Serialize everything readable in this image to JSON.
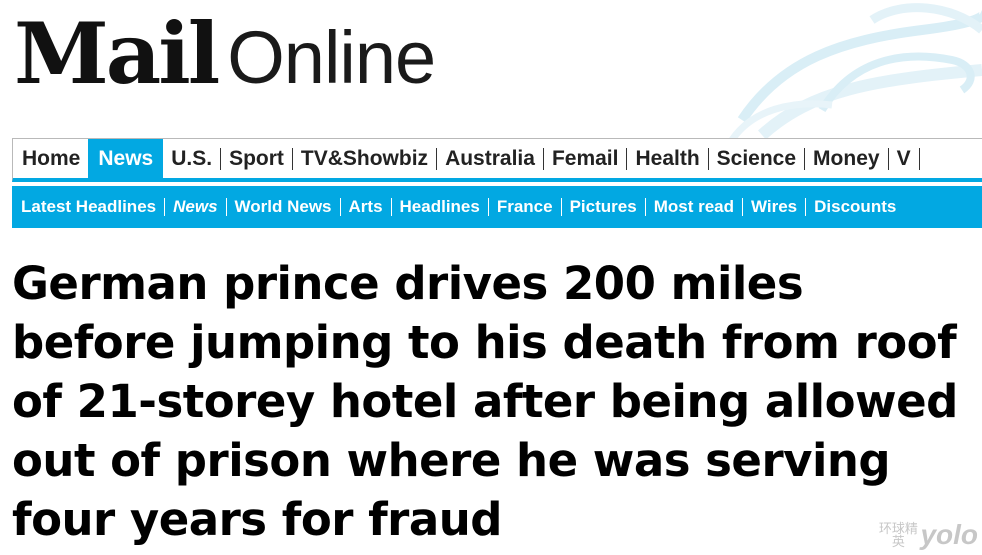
{
  "logo": {
    "mail": "Mail",
    "online": "Online"
  },
  "nav_primary": [
    {
      "label": "Home",
      "active": false
    },
    {
      "label": "News",
      "active": true
    },
    {
      "label": "U.S.",
      "active": false
    },
    {
      "label": "Sport",
      "active": false
    },
    {
      "label": "TV&Showbiz",
      "active": false
    },
    {
      "label": "Australia",
      "active": false
    },
    {
      "label": "Femail",
      "active": false
    },
    {
      "label": "Health",
      "active": false
    },
    {
      "label": "Science",
      "active": false
    },
    {
      "label": "Money",
      "active": false
    },
    {
      "label": "V",
      "active": false
    }
  ],
  "nav_secondary": [
    {
      "label": "Latest Headlines",
      "active": false
    },
    {
      "label": "News",
      "active": true
    },
    {
      "label": "World News",
      "active": false
    },
    {
      "label": "Arts",
      "active": false
    },
    {
      "label": "Headlines",
      "active": false
    },
    {
      "label": "France",
      "active": false
    },
    {
      "label": "Pictures",
      "active": false
    },
    {
      "label": "Most read",
      "active": false
    },
    {
      "label": "Wires",
      "active": false
    },
    {
      "label": "Discounts",
      "active": false
    }
  ],
  "headline": "German prince drives 200 miles before jumping to his death from roof of 21-storey hotel after being allowed out of prison where he was serving four years for fraud",
  "watermark": {
    "cn": "环球精英",
    "en": "yolo"
  },
  "colors": {
    "accent": "#02a8e2",
    "text": "#000000",
    "wave": "#d9eef6"
  }
}
